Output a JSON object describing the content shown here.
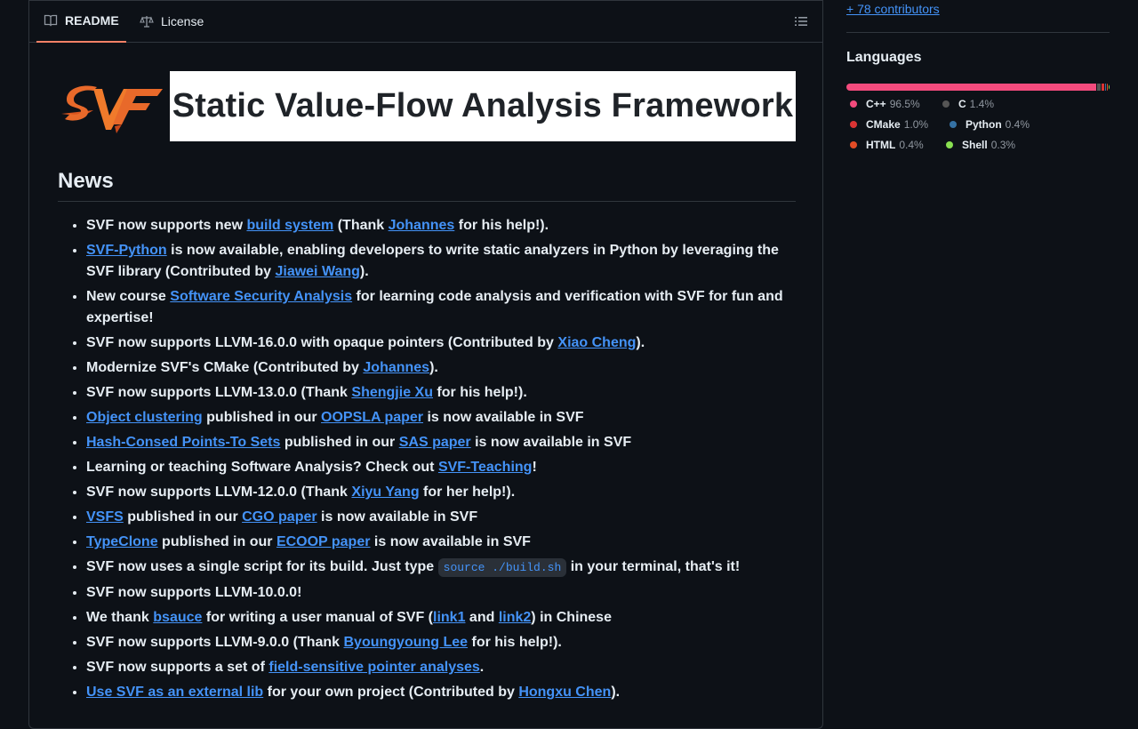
{
  "tabs": {
    "readme": "README",
    "license": "License"
  },
  "banner": {
    "title": "Static Value-Flow Analysis Framework"
  },
  "news": {
    "heading": "News",
    "code_snippet": "source ./build.sh",
    "items": [
      [
        {
          "t": "SVF now supports new "
        },
        {
          "a": "build system"
        },
        {
          "t": " (Thank "
        },
        {
          "a": "Johannes"
        },
        {
          "t": " for his help!)."
        }
      ],
      [
        {
          "a": "SVF-Python"
        },
        {
          "t": " is now available, enabling developers to write static analyzers in Python by leveraging the SVF library (Contributed by "
        },
        {
          "a": "Jiawei Wang"
        },
        {
          "t": ")."
        }
      ],
      [
        {
          "t": "New course "
        },
        {
          "a": "Software Security Analysis"
        },
        {
          "t": " for learning code analysis and verification with SVF for fun and expertise!"
        }
      ],
      [
        {
          "t": "SVF now supports LLVM-16.0.0 with opaque pointers (Contributed by "
        },
        {
          "a": "Xiao Cheng"
        },
        {
          "t": ")."
        }
      ],
      [
        {
          "t": "Modernize SVF's CMake (Contributed by "
        },
        {
          "a": "Johannes"
        },
        {
          "t": ")."
        }
      ],
      [
        {
          "t": "SVF now supports LLVM-13.0.0 (Thank "
        },
        {
          "a": "Shengjie Xu"
        },
        {
          "t": " for his help!)."
        }
      ],
      [
        {
          "a": "Object clustering"
        },
        {
          "t": " published in our "
        },
        {
          "a": "OOPSLA paper"
        },
        {
          "t": " is now available in SVF"
        }
      ],
      [
        {
          "a": "Hash-Consed Points-To Sets"
        },
        {
          "t": " published in our "
        },
        {
          "a": "SAS paper"
        },
        {
          "t": " is now available in SVF"
        }
      ],
      [
        {
          "t": "Learning or teaching Software Analysis? Check out "
        },
        {
          "a": "SVF-Teaching"
        },
        {
          "t": "!"
        }
      ],
      [
        {
          "t": "SVF now supports LLVM-12.0.0 (Thank "
        },
        {
          "a": "Xiyu Yang"
        },
        {
          "t": " for her help!)."
        }
      ],
      [
        {
          "a": "VSFS"
        },
        {
          "t": " published in our "
        },
        {
          "a": "CGO paper"
        },
        {
          "t": " is now available in SVF"
        }
      ],
      [
        {
          "a": "TypeClone"
        },
        {
          "t": " published in our "
        },
        {
          "a": "ECOOP paper"
        },
        {
          "t": " is now available in SVF"
        }
      ],
      [
        {
          "t": "SVF now uses a single script for its build. Just type "
        },
        {
          "c": "source ./build.sh"
        },
        {
          "t": " in your terminal, that's it!"
        }
      ],
      [
        {
          "t": "SVF now supports LLVM-10.0.0!"
        }
      ],
      [
        {
          "t": "We thank "
        },
        {
          "a": "bsauce"
        },
        {
          "t": " for writing a user manual of SVF ("
        },
        {
          "a": "link1"
        },
        {
          "t": " and "
        },
        {
          "a": "link2"
        },
        {
          "t": ") in Chinese"
        }
      ],
      [
        {
          "t": "SVF now supports LLVM-9.0.0 (Thank "
        },
        {
          "a": "Byoungyoung Lee"
        },
        {
          "t": " for his help!)."
        }
      ],
      [
        {
          "t": "SVF now supports a set of "
        },
        {
          "a": "field-sensitive pointer analyses"
        },
        {
          "t": "."
        }
      ],
      [
        {
          "a": "Use SVF as an external lib"
        },
        {
          "t": " for your own project (Contributed by "
        },
        {
          "a": "Hongxu Chen"
        },
        {
          "t": ")."
        }
      ]
    ]
  },
  "sidebar": {
    "contributors_link": "+ 78 contributors",
    "languages_heading": "Languages",
    "languages": [
      {
        "name": "C++",
        "pct": "96.5%",
        "value": 96.5,
        "color": "#f34b7d"
      },
      {
        "name": "C",
        "pct": "1.4%",
        "value": 1.4,
        "color": "#555555"
      },
      {
        "name": "CMake",
        "pct": "1.0%",
        "value": 1.0,
        "color": "#da3434"
      },
      {
        "name": "Python",
        "pct": "0.4%",
        "value": 0.4,
        "color": "#3572a5"
      },
      {
        "name": "HTML",
        "pct": "0.4%",
        "value": 0.4,
        "color": "#e34c26"
      },
      {
        "name": "Shell",
        "pct": "0.3%",
        "value": 0.3,
        "color": "#89e051"
      }
    ]
  }
}
